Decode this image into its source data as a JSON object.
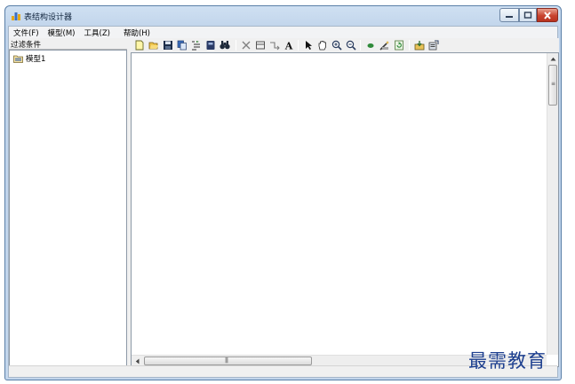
{
  "window": {
    "title": "表结构设计器"
  },
  "menu": {
    "file": "文件(F)",
    "model": "模型(M)",
    "tools": "工具(Z)",
    "help": "帮助(H)"
  },
  "left_panel": {
    "header": "过滤条件",
    "tree": [
      {
        "label": "模型1",
        "icon": "model-folder-icon"
      }
    ]
  },
  "toolbar": {
    "buttons": [
      "new-icon",
      "open-folder-icon",
      "save-icon",
      "copy-icon",
      "indent-icon",
      "book-icon",
      "find-icon",
      "delete-icon",
      "table-icon",
      "relation-icon",
      "text-icon",
      "pointer-icon",
      "hand-icon",
      "zoom-in-icon",
      "zoom-out-icon",
      "dot-icon",
      "wand-icon",
      "refresh-icon",
      "import-icon",
      "export-icon"
    ]
  },
  "watermark": "最需教育",
  "colors": {
    "title_bar": "#c3d6ec",
    "close_button": "#c8432f",
    "watermark": "#1d3f8f"
  }
}
